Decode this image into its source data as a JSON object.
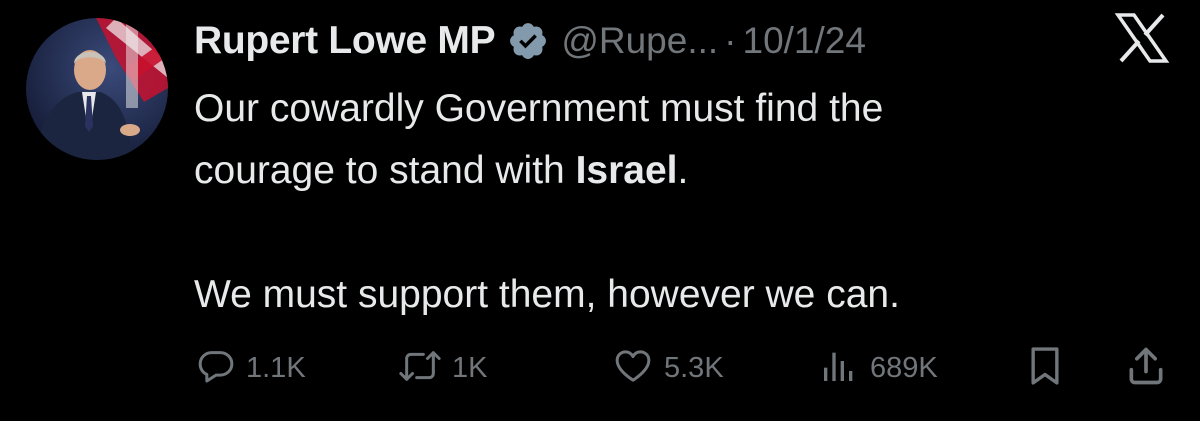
{
  "tweet": {
    "author": {
      "display_name": "Rupert Lowe MP",
      "verified": true,
      "handle": "@Rupe...",
      "separator": "·",
      "timestamp": "10/1/24"
    },
    "body": {
      "line1": "Our cowardly Government must find the",
      "line2_pre": "courage to stand with ",
      "line2_bold": "Israel",
      "line2_post": ".",
      "line3": "We must support them, however we can."
    },
    "actions": {
      "replies": "1.1K",
      "reposts": "1K",
      "likes": "5.3K",
      "views": "689K"
    }
  },
  "icons": {
    "brand": "x-logo-icon",
    "verified": "verified-badge-icon",
    "reply": "reply-icon",
    "repost": "repost-icon",
    "like": "heart-icon",
    "views": "views-icon",
    "bookmark": "bookmark-icon",
    "share": "share-icon"
  },
  "colors": {
    "background": "#000000",
    "primary_text": "#e7e9ea",
    "secondary_text": "#71767b",
    "verified_badge": "#829aab"
  }
}
